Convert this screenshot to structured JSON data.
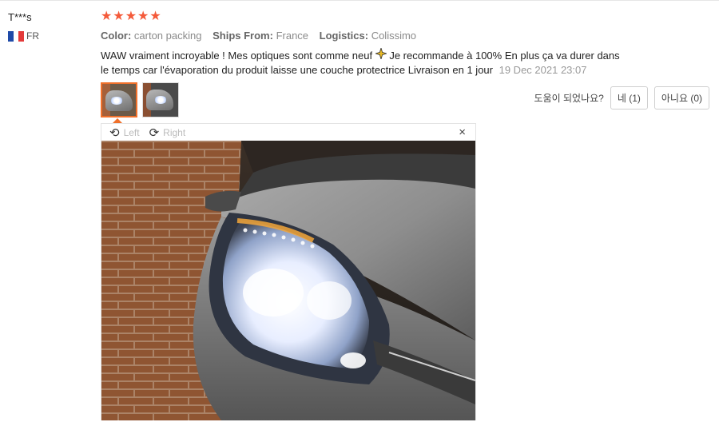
{
  "review": {
    "user_name": "T***s",
    "country_code": "FR",
    "flag_colors": [
      "#1f4aa8",
      "#ffffff",
      "#e33a3a"
    ],
    "rating": 5,
    "star_glyph": "★",
    "star_color": "#f45a3a",
    "color_key": "Color:",
    "color_value": "carton packing",
    "ships_key": "Ships From:",
    "ships_value": "France",
    "logistics_key": "Logistics:",
    "logistics_value": "Colissimo",
    "text_part1": "WAW vraiment incroyable ! Mes optiques sont comme neuf",
    "emoji_icon": "sparkles-icon",
    "text_part2": "Je recommande à 100% En plus ça va durer dans le temps car l'évaporation du produit laisse une couche protectrice Livraison en 1 jour",
    "date": "19 Dec 2021 23:07"
  },
  "helpful": {
    "question": "도움이 되었나요?",
    "yes_label": "네 (1)",
    "no_label": "아니요 (0)"
  },
  "viewer": {
    "rotate_left_label": "Left",
    "rotate_right_label": "Right",
    "close_glyph": "×",
    "accent_color": "#f0702a"
  }
}
